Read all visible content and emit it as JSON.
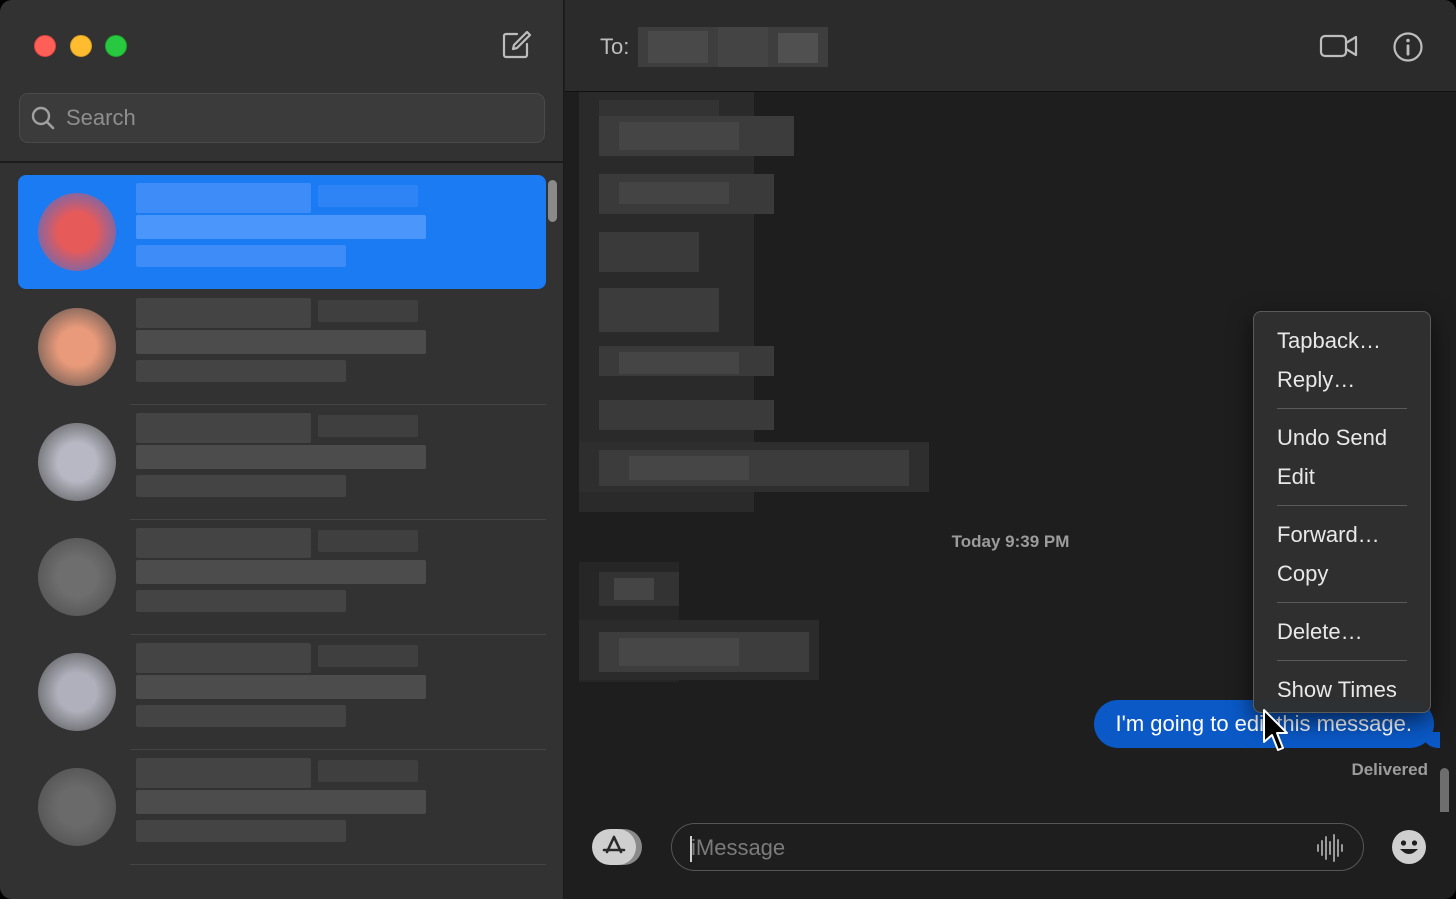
{
  "window": {
    "traffic_lights": {
      "close": "#ff5f57",
      "minimize": "#febc2e",
      "maximize": "#28c840"
    }
  },
  "sidebar": {
    "compose_icon": "compose-icon",
    "search": {
      "placeholder": "Search",
      "value": ""
    },
    "conversations": [
      {
        "selected": true,
        "avatar_color": "#e65a5a"
      },
      {
        "selected": false,
        "avatar_color": "#e89a7a"
      },
      {
        "selected": false,
        "avatar_color": "#b8b8c4"
      },
      {
        "selected": false,
        "avatar_color": "#6e6e6e"
      },
      {
        "selected": false,
        "avatar_color": "#b0b0bc"
      },
      {
        "selected": false,
        "avatar_color": "#6a6a6a"
      }
    ]
  },
  "chat": {
    "header": {
      "to_label": "To:",
      "to_value": ""
    },
    "timestamp": "Today 9:39 PM",
    "sent_message": "I'm going to edit this message.",
    "status": "Delivered",
    "input": {
      "placeholder": "iMessage",
      "value": ""
    },
    "accent_color": "#0a59c7"
  },
  "context_menu": {
    "groups": [
      [
        "Tapback…",
        "Reply…"
      ],
      [
        "Undo Send",
        "Edit"
      ],
      [
        "Forward…",
        "Copy"
      ],
      [
        "Delete…"
      ],
      [
        "Show Times"
      ]
    ]
  }
}
